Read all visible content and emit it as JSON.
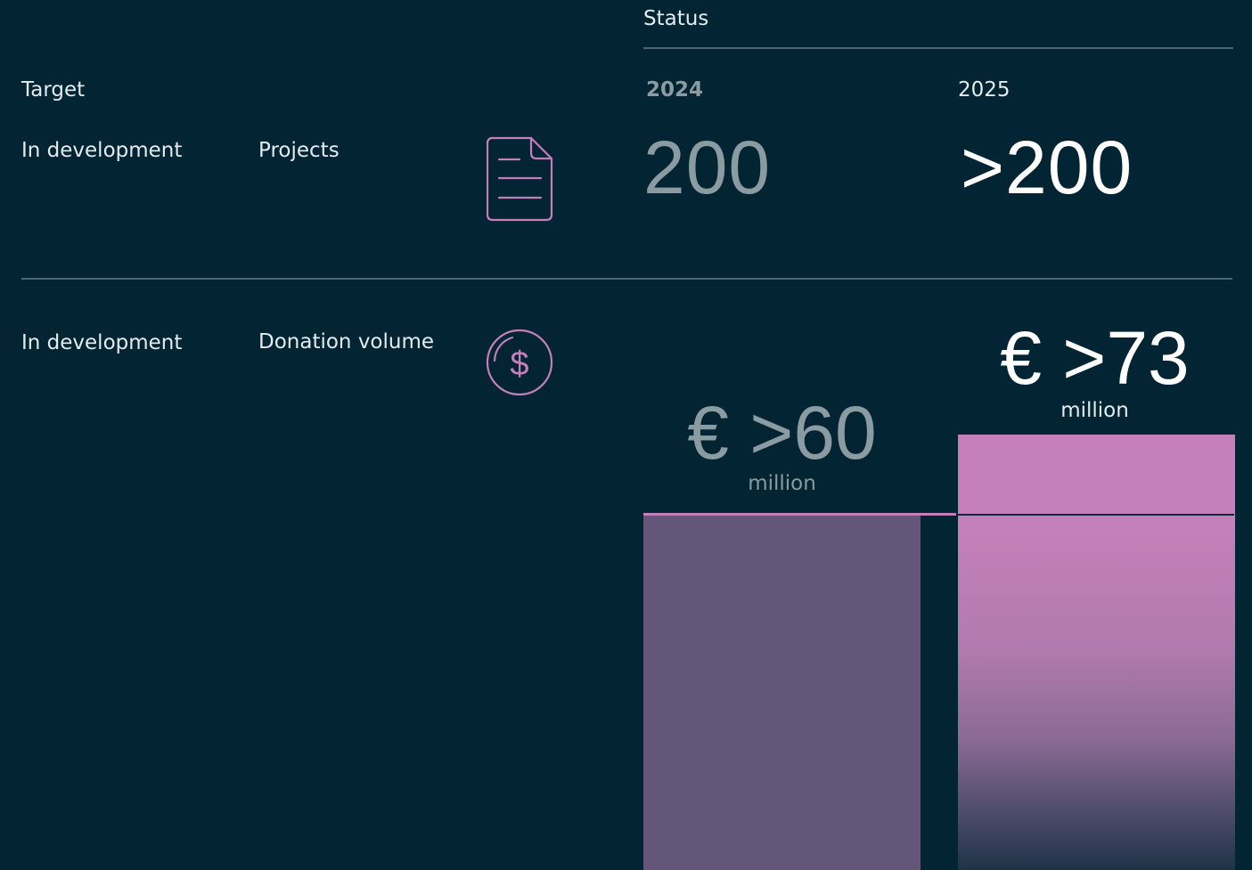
{
  "header": {
    "status_label": "Status",
    "target_label": "Target",
    "year_2024": "2024",
    "year_2025": "2025"
  },
  "rows": [
    {
      "status": "In development",
      "metric": "Projects",
      "icon": "document-icon",
      "value_2024": "200",
      "value_2025": ">200"
    },
    {
      "status": "In development",
      "metric": "Donation volume",
      "icon": "dollar-coin-icon",
      "value_2024": "€ >60",
      "unit_2024": "million",
      "value_2025": "€ >73",
      "unit_2025": "million"
    }
  ],
  "chart_data": {
    "type": "bar",
    "categories": [
      "2024",
      "2025"
    ],
    "values": [
      60,
      73
    ],
    "title": "",
    "xlabel": "",
    "ylabel": ""
  },
  "colors": {
    "background": "#022433",
    "accent": "#c47fbb",
    "muted": "#8a9ba2",
    "bar_2024": "#645678",
    "bar_2025": "#c580bb"
  }
}
